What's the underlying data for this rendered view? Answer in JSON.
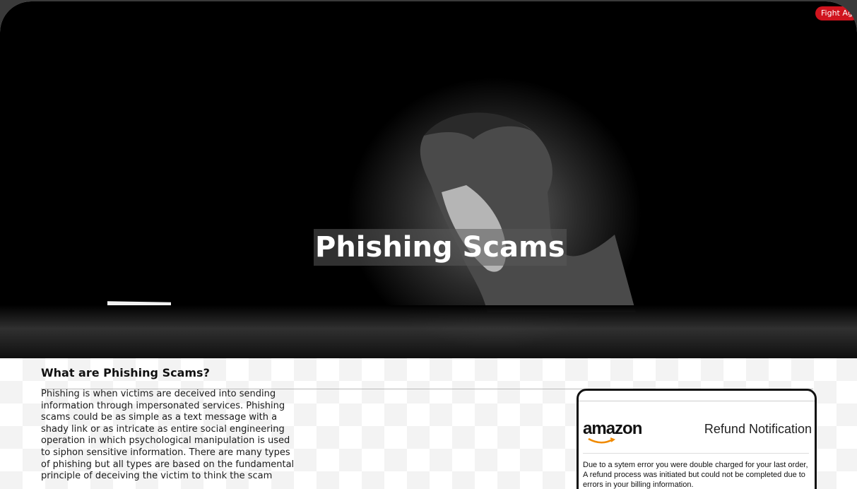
{
  "badge": {
    "label": "Fight Ag"
  },
  "hero": {
    "title": "Phishing Scams"
  },
  "section": {
    "title": "What are Phishing Scams?",
    "body": "Phishing is when victims are deceived into sending information through impersonated services. Phishing scams could be as simple as a text message with a shady link or as intricate as entire social engineering operation in which psychological manipulation is used to siphon sensitive information. There are many types of phishing but all types are based on the fundamental principle of deceiving the victim to think the scam"
  },
  "email_example": {
    "brand": "amazon",
    "heading": "Refund Notification",
    "body": "Due to a sytem error you were double charged for your last order, A refund process was initiated but could not be completed due to errors in your billing information."
  }
}
